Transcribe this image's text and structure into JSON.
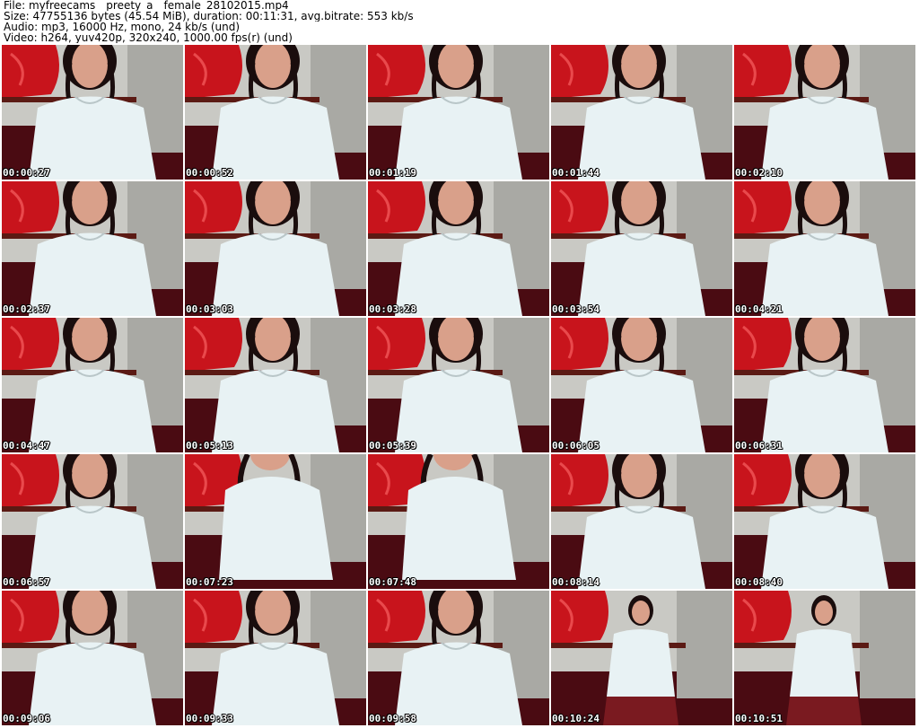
{
  "header": {
    "file": "File: myfreecams__preety_a__female_28102015.mp4",
    "size": "Size: 47755136 bytes (45.54 MiB), duration: 00:11:31, avg.bitrate: 553 kb/s",
    "audio": "Audio: mp3, 16000 Hz, mono, 24 kb/s (und)",
    "video": "Video: h264, yuv420p, 320x240, 1000.00 fps(r) (und)"
  },
  "thumbnails": [
    {
      "timestamp": "00:00:27",
      "variant": "close"
    },
    {
      "timestamp": "00:00:52",
      "variant": "close"
    },
    {
      "timestamp": "00:01:19",
      "variant": "close"
    },
    {
      "timestamp": "00:01:44",
      "variant": "close"
    },
    {
      "timestamp": "00:02:10",
      "variant": "close"
    },
    {
      "timestamp": "00:02:37",
      "variant": "close"
    },
    {
      "timestamp": "00:03:03",
      "variant": "close"
    },
    {
      "timestamp": "00:03:28",
      "variant": "close"
    },
    {
      "timestamp": "00:03:54",
      "variant": "close"
    },
    {
      "timestamp": "00:04:21",
      "variant": "close"
    },
    {
      "timestamp": "00:04:47",
      "variant": "close"
    },
    {
      "timestamp": "00:05:13",
      "variant": "close"
    },
    {
      "timestamp": "00:05:39",
      "variant": "close"
    },
    {
      "timestamp": "00:06:05",
      "variant": "close"
    },
    {
      "timestamp": "00:06:31",
      "variant": "close"
    },
    {
      "timestamp": "00:06:57",
      "variant": "close"
    },
    {
      "timestamp": "00:07:23",
      "variant": "lean"
    },
    {
      "timestamp": "00:07:48",
      "variant": "lean"
    },
    {
      "timestamp": "00:08:14",
      "variant": "close"
    },
    {
      "timestamp": "00:08:40",
      "variant": "close"
    },
    {
      "timestamp": "00:09:06",
      "variant": "close"
    },
    {
      "timestamp": "00:09:33",
      "variant": "close"
    },
    {
      "timestamp": "00:09:58",
      "variant": "close"
    },
    {
      "timestamp": "00:10:24",
      "variant": "far"
    },
    {
      "timestamp": "00:10:51",
      "variant": "far"
    }
  ],
  "colors": {
    "wall": "#c9c9c4",
    "curtain": "#c8141c",
    "floor": "#4a0b12",
    "shirt": "#e8f2f4",
    "skin": "#d9a08a",
    "hair": "#1a0d0d",
    "skirt": "#7a1a20"
  }
}
